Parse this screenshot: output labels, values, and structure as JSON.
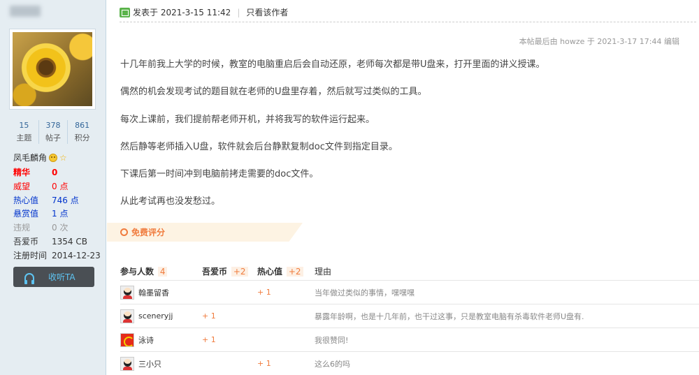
{
  "sidebar": {
    "stats": [
      {
        "value": "15",
        "label": "主题"
      },
      {
        "value": "378",
        "label": "帖子"
      },
      {
        "value": "861",
        "label": "积分"
      }
    ],
    "rank": "凤毛麟角",
    "info": [
      {
        "key": "精华",
        "value": "0"
      },
      {
        "key": "威望",
        "value": "0 点"
      },
      {
        "key": "热心值",
        "value": "746 点"
      },
      {
        "key": "悬赏值",
        "value": "1 点"
      },
      {
        "key": "违规",
        "value": "0 次"
      },
      {
        "key": "吾爱币",
        "value": "1354 CB"
      },
      {
        "key": "注册时间",
        "value": "2014-12-23"
      }
    ],
    "listen_label": "收听TA"
  },
  "post": {
    "posted": "发表于 2021-3-15 11:42",
    "author_only": "只看该作者",
    "edited_note": "本帖最后由 howze 于 2021-3-17 17:44 编辑",
    "paragraphs": [
      "十几年前我上大学的时候，教室的电脑重启后会自动还原，老师每次都是带U盘来，打开里面的讲义授课。",
      "偶然的机会发现考试的题目就在老师的U盘里存着，然后就写过类似的工具。",
      "每次上课前，我们提前帮老师开机，并将我写的软件运行起来。",
      "然后静等老师插入U盘，软件就会后台静默复制doc文件到指定目录。",
      "下课后第一时间冲到电脑前拷走需要的doc文件。",
      "从此考试再也没发愁过。"
    ]
  },
  "rating": {
    "label": "免费评分",
    "headers": {
      "participants": "参与人数",
      "participants_count": "4",
      "coin": "吾爱币",
      "coin_total": "+2",
      "heart": "热心值",
      "heart_total": "+2",
      "reason": "理由"
    },
    "rows": [
      {
        "user": "翰墨留香",
        "coin": "",
        "heart": "+ 1",
        "reason": "当年做过类似的事情，嘿嘿嘿"
      },
      {
        "user": "sceneryjj",
        "coin": "+ 1",
        "heart": "",
        "reason": "暴露年龄啊，也是十几年前，也干过这事，只是教室电脑有杀毒软件老师U盘有."
      },
      {
        "user": "泳诗",
        "coin": "+ 1",
        "heart": "",
        "reason": "我很赞同!"
      },
      {
        "user": "三小只",
        "coin": "",
        "heart": "+ 1",
        "reason": "这么6的吗"
      }
    ]
  }
}
